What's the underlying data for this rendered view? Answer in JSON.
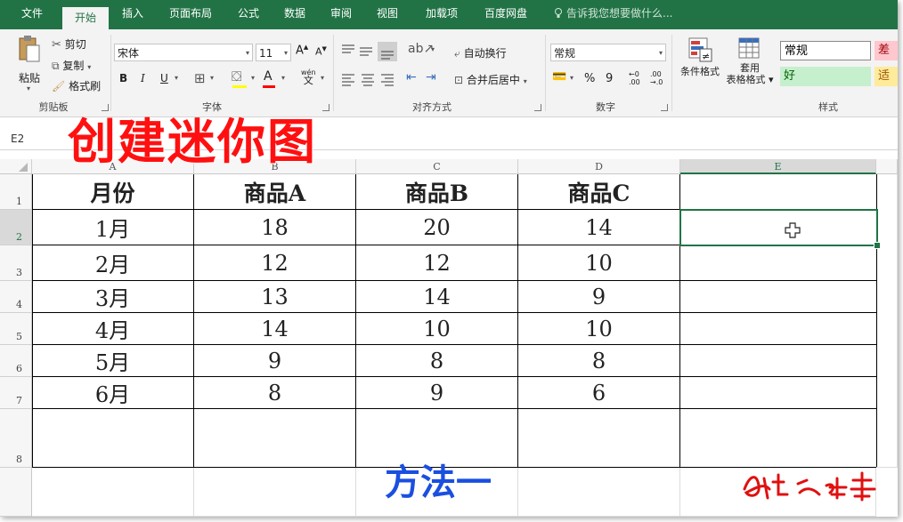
{
  "tabs": [
    "文件",
    "开始",
    "插入",
    "页面布局",
    "公式",
    "数据",
    "审阅",
    "视图",
    "加载项",
    "百度网盘"
  ],
  "active_tab": "开始",
  "tell_me": "告诉我您想要做什么...",
  "clipboard": {
    "paste": "粘贴",
    "cut": "剪切",
    "copy": "复制",
    "format_painter": "格式刷",
    "label": "剪贴板"
  },
  "font": {
    "name": "宋体",
    "size": "11",
    "bold": "B",
    "italic": "I",
    "underline": "U",
    "label": "字体",
    "phonetic": "wén"
  },
  "alignment": {
    "wrap": "自动换行",
    "merge": "合并后居中",
    "label": "对齐方式"
  },
  "number": {
    "format": "常规",
    "percent": "%",
    "comma": "9",
    "label": "数字"
  },
  "styles": {
    "conditional": "条件格式",
    "table_line1": "套用",
    "table_line2": "表格格式",
    "normal": "常规",
    "bad": "差",
    "good": "好",
    "neutral": "适",
    "label": "样式"
  },
  "name_box": "E2",
  "columns": [
    "A",
    "B",
    "C",
    "D",
    "E"
  ],
  "row_numbers": [
    "1",
    "2",
    "3",
    "4",
    "5",
    "6",
    "7",
    "8"
  ],
  "table": {
    "headers": [
      "月份",
      "商品A",
      "商品B",
      "商品C"
    ],
    "rows": [
      [
        "1月",
        "18",
        "20",
        "14"
      ],
      [
        "2月",
        "12",
        "12",
        "10"
      ],
      [
        "3月",
        "13",
        "14",
        "9"
      ],
      [
        "4月",
        "14",
        "10",
        "10"
      ],
      [
        "5月",
        "9",
        "8",
        "8"
      ],
      [
        "6月",
        "8",
        "9",
        "6"
      ]
    ]
  },
  "overlay_title": "创建迷你图",
  "overlay_method": "方法一",
  "colors": {
    "excel_green": "#217346",
    "title_red": "#ff1010",
    "method_blue": "#1a4fe0"
  }
}
